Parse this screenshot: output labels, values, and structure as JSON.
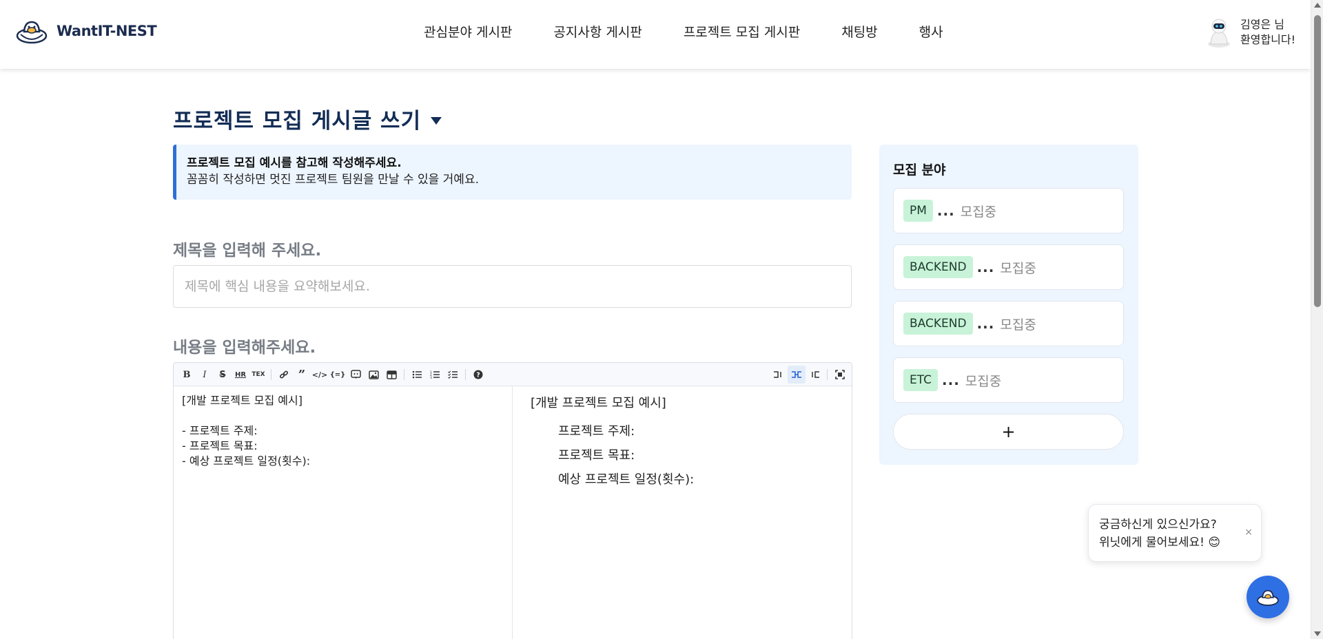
{
  "header": {
    "logo_text": "WantIT-NEST",
    "nav": [
      {
        "label": "관심분야 게시판"
      },
      {
        "label": "공지사항 게시판"
      },
      {
        "label": "프로젝트 모집 게시판"
      },
      {
        "label": "채팅방"
      },
      {
        "label": "행사"
      }
    ],
    "user": {
      "line1": "김영은 님",
      "line2": "환영합니다!"
    }
  },
  "page": {
    "title": "프로젝트 모집 게시글 쓰기",
    "notice": {
      "strong": "프로젝트 모집 예시를 참고해 작성해주세요.",
      "sub": "꼼꼼히 작성하면 멋진 프로젝트 팀원을 만날 수 있을 거예요."
    },
    "title_label": "제목을 입력해 주세요.",
    "title_placeholder": "제목에 핵심 내용을 요약해보세요.",
    "title_value": "",
    "content_label": "내용을 입력해주세요."
  },
  "editor": {
    "toolbar_icons": [
      "bold-icon",
      "italic-icon",
      "strike-icon",
      "hr-icon",
      "quote-block-icon",
      "link-icon",
      "blockquote-icon",
      "code-icon",
      "codeblock-icon",
      "embed-icon",
      "image-icon",
      "table-icon",
      "bullet-list-icon",
      "ordered-list-icon",
      "task-list-icon",
      "help-icon"
    ],
    "markdown_lines": [
      "[개발 프로젝트 모집 예시]",
      "",
      "- 프로젝트 주제:",
      "- 프로젝트 목표:",
      "- 예상 프로젝트 일정(횟수):"
    ],
    "preview_title": "[개발 프로젝트 모집 예시]",
    "preview_items": [
      "프로젝트 주제:",
      "프로젝트 목표:",
      "예상 프로젝트 일정(횟수):"
    ]
  },
  "sidebar": {
    "title": "모집 분야",
    "roles": [
      {
        "tag": "PM",
        "dots": "...",
        "status": "모집중"
      },
      {
        "tag": "BACKEND",
        "dots": "...",
        "status": "모집중"
      },
      {
        "tag": "BACKEND",
        "dots": "...",
        "status": "모집중"
      },
      {
        "tag": "ETC",
        "dots": "...",
        "status": "모집중"
      }
    ],
    "add_label": "+"
  },
  "chat": {
    "line1": "궁금하신게 있으신가요?",
    "line2": "위닛에게 물어보세요! 😊",
    "close": "×"
  },
  "colors": {
    "brand_navy": "#132d55",
    "accent_blue": "#2f6fd6",
    "tag_green": "#c8f3d8",
    "panel_bg": "#edf5ff"
  }
}
